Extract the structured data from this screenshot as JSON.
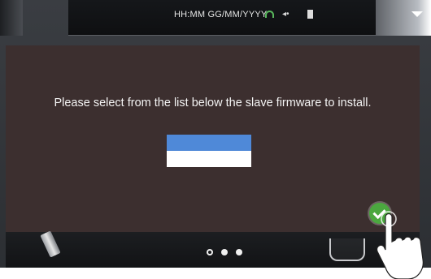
{
  "statusbar": {
    "clock_text": "HH:MM GG/MM/YYYY",
    "icons": [
      "wifi-icon",
      "volume-icon",
      "battery-icon"
    ],
    "dropdown_icon": "chevron-down-icon"
  },
  "dialog": {
    "message": "Please select from the list below the slave firmware to install.",
    "flag_colors": [
      "#4f89d8",
      "#ffffff"
    ],
    "confirm_icon": "check-icon",
    "confirm_color": "#4ba73f"
  },
  "pager": {
    "count": 3,
    "active_index": 0
  },
  "colors": {
    "dialog_bg": "#3c2f2f",
    "topbar_bg": "#15171a"
  }
}
